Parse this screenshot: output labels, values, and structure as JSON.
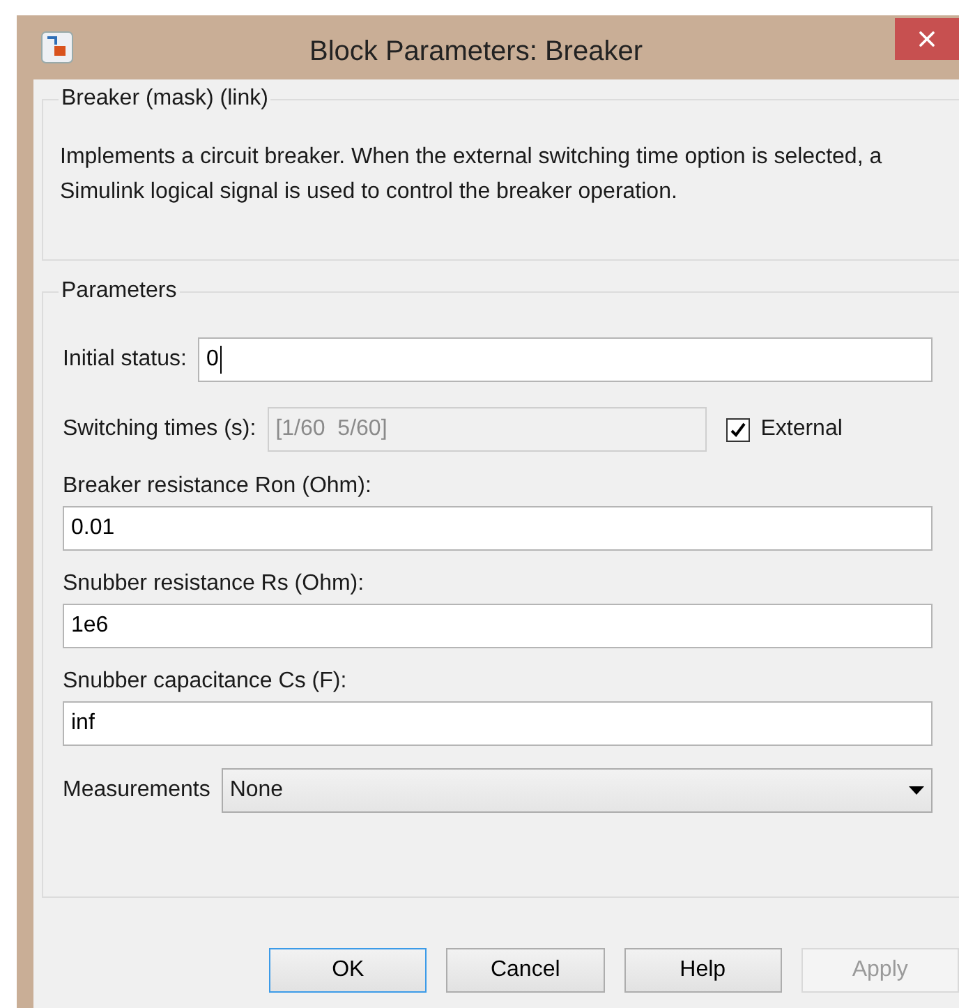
{
  "window": {
    "title": "Block Parameters: Breaker"
  },
  "description": {
    "title": "Breaker (mask) (link)",
    "text": "Implements a circuit breaker. When the external switching time option is selected, a Simulink logical signal is used to control the breaker operation."
  },
  "parameters": {
    "title": "Parameters",
    "fields": [
      {
        "kind": "inline",
        "label": "Initial status:",
        "value": "0",
        "focused": true
      },
      {
        "kind": "toggled",
        "label": "Switching times (s):",
        "value": "[1/60  5/60]",
        "disabled": true,
        "checkbox": {
          "label": "External",
          "checked": true
        }
      },
      {
        "kind": "stacked",
        "label": "Breaker resistance Ron (Ohm):",
        "value": "0.01"
      },
      {
        "kind": "stacked",
        "label": "Snubber resistance Rs (Ohm):",
        "value": "1e6"
      },
      {
        "kind": "stacked",
        "label": "Snubber capacitance Cs (F):",
        "value": "inf"
      },
      {
        "kind": "select",
        "label": "Measurements",
        "value": "None"
      }
    ]
  },
  "buttons": [
    {
      "label": "OK",
      "focused": true,
      "disabled": false
    },
    {
      "label": "Cancel",
      "focused": false,
      "disabled": false
    },
    {
      "label": "Help",
      "focused": false,
      "disabled": false
    },
    {
      "label": "Apply",
      "focused": false,
      "disabled": true
    }
  ]
}
